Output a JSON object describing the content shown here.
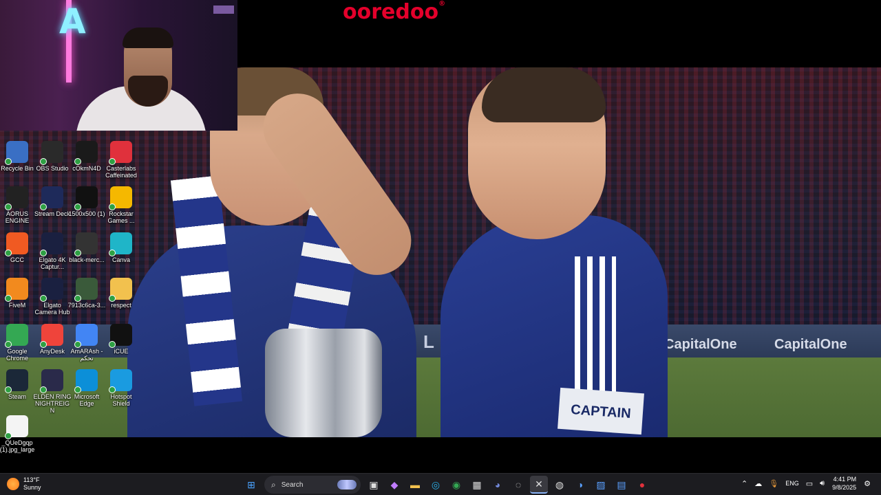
{
  "broadcast": {
    "sponsor_logo": "ooredoo",
    "hoarding_text": "L LEAGUE",
    "hoarding_brand_1": "CapitalOne",
    "hoarding_brand_2": "CapitalOne",
    "armband_text": "CAPTAIN"
  },
  "desktop_icons": [
    {
      "label": "Recycle Bin",
      "icon": "recycle-bin-icon",
      "color": "#3a6fc4"
    },
    {
      "label": "OBS Studio",
      "icon": "obs-icon",
      "color": "#2a2a2a"
    },
    {
      "label": "cOkmN4D",
      "icon": "image-file-icon",
      "color": "#1a1a1a"
    },
    {
      "label": "Casterlabs Caffeinated",
      "icon": "casterlabs-icon",
      "color": "#e0313c"
    },
    {
      "label": "AORUS ENGINE",
      "icon": "aorus-icon",
      "color": "#222"
    },
    {
      "label": "Stream Deck",
      "icon": "stream-deck-icon",
      "color": "#1e2a5a"
    },
    {
      "label": "1500x500 (1)",
      "icon": "image-file-icon",
      "color": "#111"
    },
    {
      "label": "Rockstar Games ...",
      "icon": "rockstar-icon",
      "color": "#f5b800"
    },
    {
      "label": "GCC",
      "icon": "gcc-icon",
      "color": "#f05a22"
    },
    {
      "label": "Elgato 4K Captur...",
      "icon": "elgato-4k-icon",
      "color": "#1a2040"
    },
    {
      "label": "black-merc...",
      "icon": "image-file-icon",
      "color": "#333"
    },
    {
      "label": "Canva",
      "icon": "canva-icon",
      "color": "#1fb5c8"
    },
    {
      "label": "FiveM",
      "icon": "fivem-icon",
      "color": "#f28a1e"
    },
    {
      "label": "Elgato Camera Hub",
      "icon": "elgato-camera-icon",
      "color": "#1a2040"
    },
    {
      "label": "7913c6ca-3...",
      "icon": "image-file-icon",
      "color": "#3a5a3a"
    },
    {
      "label": "respect",
      "icon": "folder-icon",
      "color": "#f2c14e"
    },
    {
      "label": "Google Chrome",
      "icon": "chrome-icon",
      "color": "#34a853"
    },
    {
      "label": "AnyDesk",
      "icon": "anydesk-icon",
      "color": "#ef443b"
    },
    {
      "label": "AmARAsh - تحكم",
      "icon": "chrome-app-icon",
      "color": "#4285f4"
    },
    {
      "label": "iCUE",
      "icon": "icue-icon",
      "color": "#111"
    },
    {
      "label": "Steam",
      "icon": "steam-icon",
      "color": "#1b2838"
    },
    {
      "label": "ELDEN RING NIGHTREIGN",
      "icon": "elden-ring-icon",
      "color": "#2a2a4a"
    },
    {
      "label": "Microsoft Edge",
      "icon": "edge-icon",
      "color": "#0c8fd8"
    },
    {
      "label": "Hotspot Shield",
      "icon": "hotspot-shield-icon",
      "color": "#1a9be0"
    },
    {
      "label": "_QUeDgqp (1).jpg_large",
      "icon": "blank-file-icon",
      "color": "#f4f4f4"
    }
  ],
  "taskbar": {
    "weather": {
      "temp": "113°F",
      "condition": "Sunny"
    },
    "search_placeholder": "Search",
    "apps": [
      {
        "name": "start-button",
        "glyph": "⊞",
        "color": "#4aa3ff"
      },
      {
        "name": "task-view-icon",
        "glyph": "▣",
        "color": "#ddd"
      },
      {
        "name": "copilot-icon",
        "glyph": "◆",
        "color": "#c07cff"
      },
      {
        "name": "file-explorer-icon",
        "glyph": "▬",
        "color": "#f2c14e"
      },
      {
        "name": "edge-icon",
        "glyph": "◎",
        "color": "#2bb0e8"
      },
      {
        "name": "chrome-icon",
        "glyph": "◉",
        "color": "#34a853"
      },
      {
        "name": "store-icon",
        "glyph": "▦",
        "color": "#ddd"
      },
      {
        "name": "discord-icon",
        "glyph": "◕",
        "color": "#7289da"
      },
      {
        "name": "obs-icon",
        "glyph": "◌",
        "color": "#ddd"
      },
      {
        "name": "capcut-icon",
        "glyph": "✕",
        "color": "#ddd"
      },
      {
        "name": "steam-icon",
        "glyph": "◍",
        "color": "#ddd"
      },
      {
        "name": "elgato-icon",
        "glyph": "◑",
        "color": "#5aa0ff"
      },
      {
        "name": "photos-icon",
        "glyph": "▨",
        "color": "#5aa0ff"
      },
      {
        "name": "virtual-machine-icon",
        "glyph": "▤",
        "color": "#5aa0ff"
      },
      {
        "name": "casterlabs-icon",
        "glyph": "●",
        "color": "#e0313c"
      }
    ],
    "tray": {
      "language": "ENG",
      "time": "4:41 PM",
      "date": "9/8/2025"
    }
  }
}
